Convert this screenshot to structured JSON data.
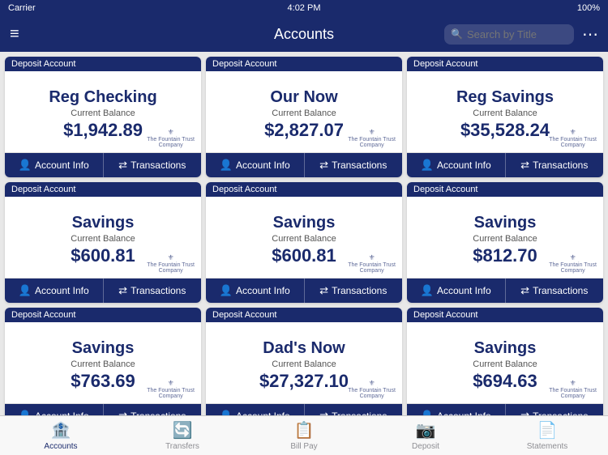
{
  "statusBar": {
    "carrier": "Carrier",
    "time": "4:02 PM",
    "battery": "100%",
    "wifi": "WiFi"
  },
  "navBar": {
    "menuIcon": "≡",
    "title": "Accounts",
    "searchPlaceholder": "Search by Title",
    "moreIcon": "⋯"
  },
  "accounts": [
    {
      "type": "Deposit Account",
      "name": "Reg Checking",
      "balanceLabel": "Current Balance",
      "balance": "$1,942.89",
      "infoLabel": "Account Info",
      "transLabel": "Transactions"
    },
    {
      "type": "Deposit Account",
      "name": "Our Now",
      "balanceLabel": "Current Balance",
      "balance": "$2,827.07",
      "infoLabel": "Account Info",
      "transLabel": "Transactions"
    },
    {
      "type": "Deposit Account",
      "name": "Reg Savings",
      "balanceLabel": "Current Balance",
      "balance": "$35,528.24",
      "infoLabel": "Account Info",
      "transLabel": "Transactions"
    },
    {
      "type": "Deposit Account",
      "name": "Savings",
      "balanceLabel": "Current Balance",
      "balance": "$600.81",
      "infoLabel": "Account Info",
      "transLabel": "Transactions"
    },
    {
      "type": "Deposit Account",
      "name": "Savings",
      "balanceLabel": "Current Balance",
      "balance": "$600.81",
      "infoLabel": "Account Info",
      "transLabel": "Transactions"
    },
    {
      "type": "Deposit Account",
      "name": "Savings",
      "balanceLabel": "Current Balance",
      "balance": "$812.70",
      "infoLabel": "Account Info",
      "transLabel": "Transactions"
    },
    {
      "type": "Deposit Account",
      "name": "Savings",
      "balanceLabel": "Current Balance",
      "balance": "$763.69",
      "infoLabel": "Account Info",
      "transLabel": "Transactions"
    },
    {
      "type": "Deposit Account",
      "name": "Dad's Now",
      "balanceLabel": "Current Balance",
      "balance": "$27,327.10",
      "infoLabel": "Account Info",
      "transLabel": "Transactions"
    },
    {
      "type": "Deposit Account",
      "name": "Savings",
      "balanceLabel": "Current Balance",
      "balance": "$694.63",
      "infoLabel": "Account Info",
      "transLabel": "Transactions"
    }
  ],
  "bankLogo": {
    "line1": "The Fountain Trust",
    "line2": "Company"
  },
  "tabs": [
    {
      "icon": "🏦",
      "label": "Accounts",
      "active": true
    },
    {
      "icon": "🔄",
      "label": "Transfers",
      "active": false
    },
    {
      "icon": "📋",
      "label": "Bill Pay",
      "active": false
    },
    {
      "icon": "📷",
      "label": "Deposit",
      "active": false
    },
    {
      "icon": "📄",
      "label": "Statements",
      "active": false
    }
  ],
  "colors": {
    "primary": "#1a2a6c",
    "background": "#e8e8e8",
    "cardBg": "#ffffff"
  }
}
